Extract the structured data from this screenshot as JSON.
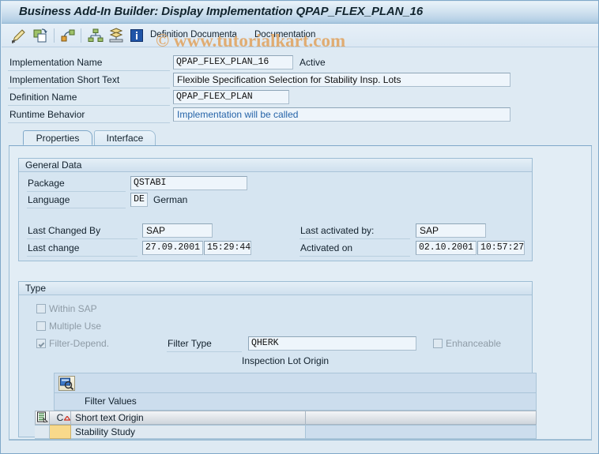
{
  "window": {
    "title": "Business Add-In Builder: Display Implementation QPAP_FLEX_PLAN_16"
  },
  "watermark": {
    "text": "© www.tutorialkart.com"
  },
  "toolbar": {
    "icons": [
      {
        "name": "change-pencil-icon",
        "title": "Change"
      },
      {
        "name": "copy-icon",
        "title": "Copy"
      },
      {
        "name": "other-object-icon",
        "title": "Other Object"
      },
      {
        "name": "hierarchy-icon",
        "title": "Hierarchy Display"
      },
      {
        "name": "stack-icon",
        "title": "Stack"
      },
      {
        "name": "information-icon",
        "title": "Information"
      }
    ],
    "links": [
      {
        "name": "definition-documentation-link",
        "label": "Definition Documenta"
      },
      {
        "name": "documentation-link",
        "label": "Documentation"
      }
    ]
  },
  "header_form": {
    "rows": [
      {
        "label": "Implementation Name",
        "value": "QPAP_FLEX_PLAN_16",
        "status": "Active"
      },
      {
        "label": "Implementation Short Text",
        "value": "Flexible Specification Selection for Stability Insp. Lots"
      },
      {
        "label": "Definition Name",
        "value": "QPAP_FLEX_PLAN"
      },
      {
        "label": "Runtime Behavior",
        "value": "Implementation will be called"
      }
    ]
  },
  "tabs": [
    {
      "label": "Properties",
      "active": true
    },
    {
      "label": "Interface",
      "active": false
    }
  ],
  "general_data": {
    "title": "General Data",
    "package_label": "Package",
    "package_value": "QSTABI",
    "language_label": "Language",
    "language_code": "DE",
    "language_name": "German",
    "last_changed_by_label": "Last Changed By",
    "last_changed_by_value": "SAP",
    "last_change_label": "Last change",
    "last_change_date": "27.09.2001",
    "last_change_time": "15:29:44",
    "last_activated_by_label": "Last activated by:",
    "last_activated_by_value": "SAP",
    "activated_on_label": "Activated on",
    "activated_on_date": "02.10.2001",
    "activated_on_time": "10:57:27"
  },
  "type_section": {
    "title": "Type",
    "checkboxes": [
      {
        "label": "Within SAP",
        "checked": false
      },
      {
        "label": "Multiple Use",
        "checked": false
      },
      {
        "label": "Filter-Depend.",
        "checked": true
      }
    ],
    "enhanceable": {
      "label": "Enhanceable",
      "checked": false
    },
    "filter_type_label": "Filter Type",
    "filter_type_value": "QHERK",
    "filter_type_description": "Inspection Lot Origin"
  },
  "filter_values": {
    "display_button_name": "display-filter-values-button",
    "caption": "Filter Values",
    "columns": [
      {
        "label": "C",
        "sorted": true
      },
      {
        "label": "Short text Origin"
      }
    ],
    "rows": [
      {
        "code": "",
        "short_text": "Stability Study"
      }
    ]
  },
  "colors": {
    "window_bg": "#deeaf3",
    "panel_bg": "#d6e5f1",
    "tab_body_bg": "#e2edf5",
    "border": "#9dbdd4",
    "field_bg": "#eef5fb",
    "accent_blue": "#2563a8",
    "watermark": "#e0ac72",
    "yellow_cell": "#f8d98b"
  }
}
